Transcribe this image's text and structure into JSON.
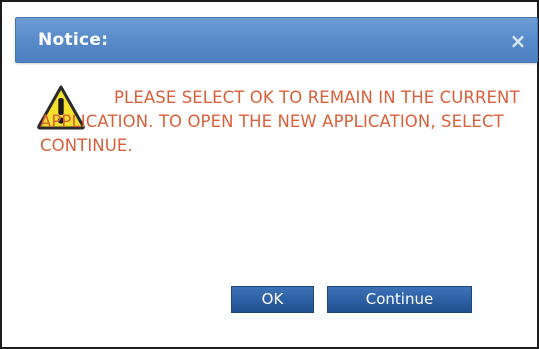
{
  "dialog": {
    "title": "Notice:",
    "close_icon": "×",
    "message": "PLEASE SELECT OK TO REMAIN IN THE CURRENT APPLICATION. TO OPEN THE NEW APPLICATION, SELECT CONTINUE.",
    "icon": "warning-triangle-icon",
    "ok_label": "OK",
    "continue_label": "Continue"
  },
  "colors": {
    "titlebar": "#5a8ccb",
    "message_text": "#d9603b",
    "button": "#2c5fa3",
    "warning_fill": "#f5e12b"
  }
}
